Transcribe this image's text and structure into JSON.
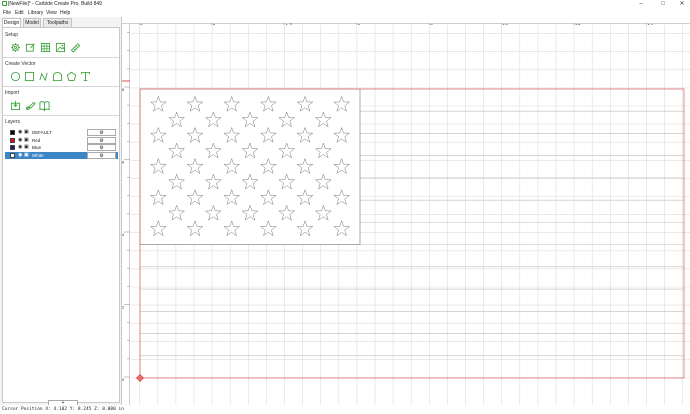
{
  "window": {
    "title": "[NewFile]* - Carbide Create Pro, Build 849",
    "minimize": "–",
    "maximize": "□",
    "close": "✕"
  },
  "menu": [
    "File",
    "Edit",
    "Library",
    "View",
    "Help"
  ],
  "tabs": [
    "Design",
    "Model",
    "Toolpaths"
  ],
  "sections": {
    "setup": "Setup",
    "create_vector": "Create Vector",
    "import": "Import",
    "layers": "Layers"
  },
  "icons": {
    "setup": [
      "gear-icon",
      "edit-icon",
      "grid-icon",
      "image-icon",
      "ruler-icon"
    ],
    "create_vector": [
      "circle-icon",
      "rectangle-icon",
      "curve-icon",
      "polygon-icon",
      "pentagon-icon",
      "text-icon"
    ],
    "import": [
      "import-icon",
      "trace-icon",
      "book-icon"
    ]
  },
  "layers": [
    {
      "name": "DEFAULT",
      "color": "#000000",
      "selected": false
    },
    {
      "name": "Red",
      "color": "#e01010",
      "selected": false
    },
    {
      "name": "Blue",
      "color": "#1a1a7a",
      "selected": false
    },
    {
      "name": "White",
      "color": "#ffffff",
      "selected": true
    }
  ],
  "layer_gear": "⚙",
  "add_layer_label": "+",
  "ruler": {
    "top_labels": [
      "0",
      "2",
      "4",
      "6",
      "8",
      "10",
      "12",
      "14"
    ],
    "left_labels": [
      "10",
      "8",
      "6",
      "4",
      "2",
      "0"
    ]
  },
  "colors": {
    "accent": "#2f9e2f",
    "selection": "#3d86c6",
    "stripe": "#e07070",
    "grid": "#dcdcdc"
  },
  "status": "Cursor Position X: 4.102 Y: 8.245 Z: 0.000 in"
}
